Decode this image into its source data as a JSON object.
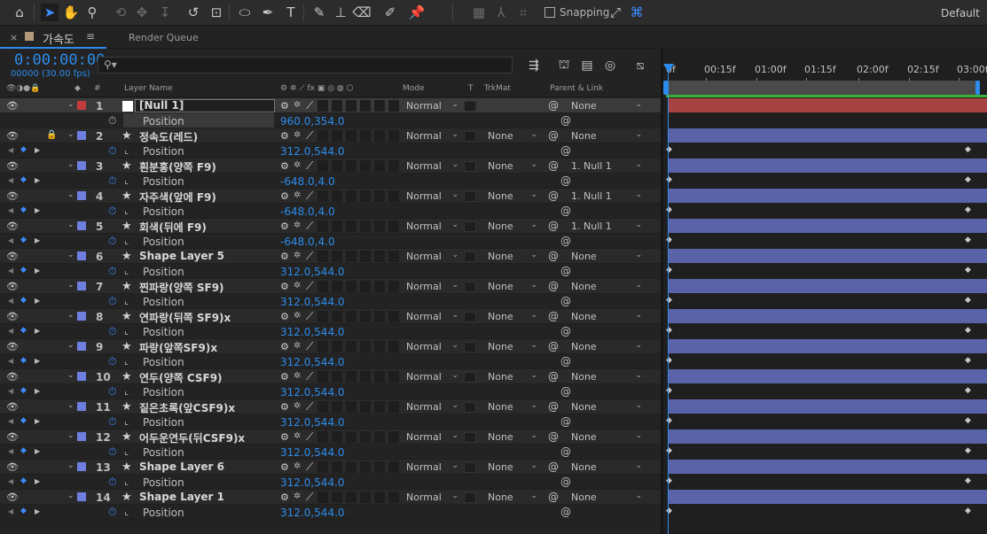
{
  "toolbar": {
    "snapping_label": "Snapping",
    "workspace": "Default",
    "tools": [
      "home-icon",
      "selection-icon",
      "hand-icon",
      "zoom-icon",
      "orbit-icon",
      "pan-icon",
      "dolly-icon",
      "rotate-icon",
      "camera-behind-icon",
      "ellipse-icon",
      "pen-icon",
      "type-icon",
      "brush-icon",
      "clone-stamp-icon",
      "eraser-icon",
      "roto-brush-icon",
      "puppet-pin-icon"
    ]
  },
  "tabs": {
    "comp_label": "가속도",
    "render_queue_label": "Render Queue",
    "comp_color": "#b39a7a"
  },
  "timecode": {
    "value": "0:00:00:00",
    "frames": "00000 (30.00 fps)"
  },
  "columns": {
    "layer_name": "Layer Name",
    "mode": "Mode",
    "t": "T",
    "trkmat": "TrkMat",
    "parent": "Parent & Link",
    "hash": "#"
  },
  "ruler": [
    "0f",
    "00:15f",
    "01:00f",
    "01:15f",
    "02:00f",
    "02:15f",
    "03:00f"
  ],
  "layers": [
    {
      "num": "1",
      "name": "[Null 1]",
      "color": "#c43c3c",
      "solid": true,
      "mode": "Normal",
      "trkmat": "",
      "parent": "None",
      "prop": "Position",
      "value": "960.0,354.0",
      "animated": false,
      "bar": "#a84343"
    },
    {
      "num": "2",
      "name": "정속도(레드)",
      "color": "#6f7fe0",
      "solid": false,
      "mode": "Normal",
      "trkmat": "None",
      "parent": "None",
      "prop": "Position",
      "value": "312.0,544.0",
      "animated": true,
      "locked": true,
      "bar": "#5a63a8"
    },
    {
      "num": "3",
      "name": "흰분홍(양쪽 F9)",
      "color": "#6f7fe0",
      "solid": false,
      "mode": "Normal",
      "trkmat": "None",
      "parent": "1. Null 1",
      "prop": "Position",
      "value": "-648.0,4.0",
      "animated": true,
      "bar": "#5a63a8"
    },
    {
      "num": "4",
      "name": "자주색(앞에 F9)",
      "color": "#6f7fe0",
      "solid": false,
      "mode": "Normal",
      "trkmat": "None",
      "parent": "1. Null 1",
      "prop": "Position",
      "value": "-648.0,4.0",
      "animated": true,
      "bar": "#5a63a8"
    },
    {
      "num": "5",
      "name": "회색(뒤에 F9)",
      "color": "#6f7fe0",
      "solid": false,
      "mode": "Normal",
      "trkmat": "None",
      "parent": "1. Null 1",
      "prop": "Position",
      "value": "-648.0,4.0",
      "animated": true,
      "bar": "#5a63a8"
    },
    {
      "num": "6",
      "name": "Shape Layer 5",
      "color": "#6f7fe0",
      "solid": false,
      "mode": "Normal",
      "trkmat": "None",
      "parent": "None",
      "prop": "Position",
      "value": "312.0,544.0",
      "animated": true,
      "bar": "#5a63a8"
    },
    {
      "num": "7",
      "name": "찐파랑(양쪽 SF9)",
      "color": "#6f7fe0",
      "solid": false,
      "mode": "Normal",
      "trkmat": "None",
      "parent": "None",
      "prop": "Position",
      "value": "312.0,544.0",
      "animated": true,
      "bar": "#5a63a8"
    },
    {
      "num": "8",
      "name": "연파랑(뒤쪽 SF9)x",
      "color": "#6f7fe0",
      "solid": false,
      "mode": "Normal",
      "trkmat": "None",
      "parent": "None",
      "prop": "Position",
      "value": "312.0,544.0",
      "animated": true,
      "bar": "#5a63a8"
    },
    {
      "num": "9",
      "name": "파랑(앞쪽SF9)x",
      "color": "#6f7fe0",
      "solid": false,
      "mode": "Normal",
      "trkmat": "None",
      "parent": "None",
      "prop": "Position",
      "value": "312.0,544.0",
      "animated": true,
      "bar": "#5a63a8"
    },
    {
      "num": "10",
      "name": "연두(양쪽 CSF9)",
      "color": "#6f7fe0",
      "solid": false,
      "mode": "Normal",
      "trkmat": "None",
      "parent": "None",
      "prop": "Position",
      "value": "312.0,544.0",
      "animated": true,
      "bar": "#5a63a8"
    },
    {
      "num": "11",
      "name": "짙은초록(앞CSF9)x",
      "color": "#6f7fe0",
      "solid": false,
      "mode": "Normal",
      "trkmat": "None",
      "parent": "None",
      "prop": "Position",
      "value": "312.0,544.0",
      "animated": true,
      "bar": "#5a63a8"
    },
    {
      "num": "12",
      "name": "어두운연두(뒤CSF9)x",
      "color": "#6f7fe0",
      "solid": false,
      "mode": "Normal",
      "trkmat": "None",
      "parent": "None",
      "prop": "Position",
      "value": "312.0,544.0",
      "animated": true,
      "bar": "#5a63a8"
    },
    {
      "num": "13",
      "name": "Shape Layer 6",
      "color": "#6f7fe0",
      "solid": false,
      "mode": "Normal",
      "trkmat": "None",
      "parent": "None",
      "prop": "Position",
      "value": "312.0,544.0",
      "animated": true,
      "bar": "#5a63a8"
    },
    {
      "num": "14",
      "name": "Shape Layer 1",
      "color": "#6f7fe0",
      "solid": false,
      "mode": "Normal",
      "trkmat": "None",
      "parent": "None",
      "prop": "Position",
      "value": "312.0,544.0",
      "animated": true,
      "bar": "#5a63a8"
    }
  ],
  "colors": {
    "accent": "#2d8ceb",
    "render_bar": "#3bb13b"
  }
}
